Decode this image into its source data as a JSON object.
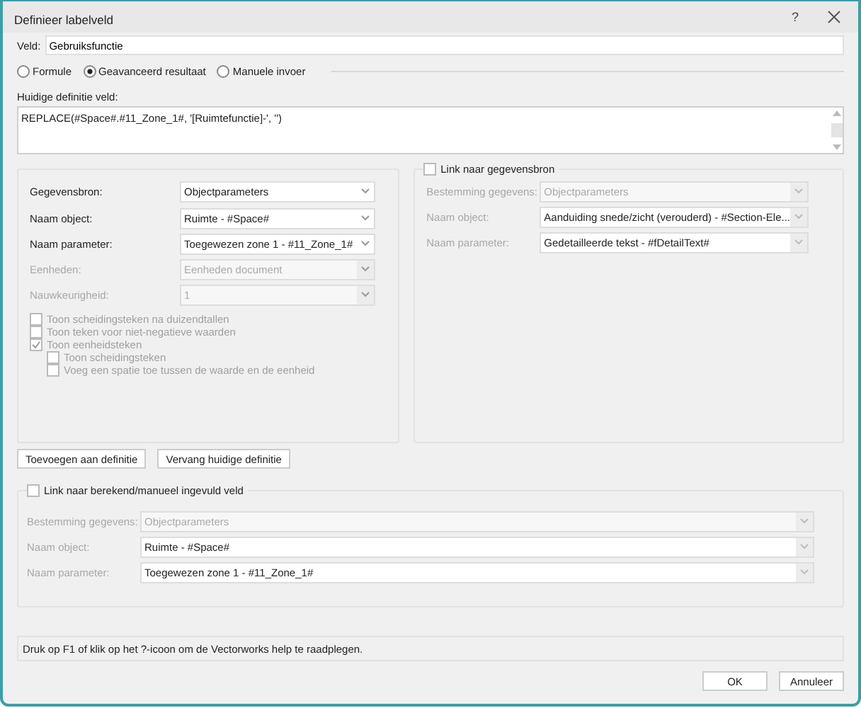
{
  "window": {
    "title": "Definieer labelveld",
    "help": "?"
  },
  "veld": {
    "label": "Veld:",
    "value": "Gebruiksfunctie"
  },
  "mode_options": [
    {
      "label": "Formule",
      "selected": false
    },
    {
      "label": "Geavanceerd resultaat",
      "selected": true
    },
    {
      "label": "Manuele invoer",
      "selected": false
    }
  ],
  "definition": {
    "label": "Huidige definitie veld:",
    "value": "REPLACE(#Space#.#11_Zone_1#, '[Ruimtefunctie]-', '')"
  },
  "source_panel": {
    "rows": [
      {
        "label": "Gegevensbron:",
        "value": "Objectparameters",
        "disabled": false
      },
      {
        "label": "Naam object:",
        "value": "Ruimte - #Space#",
        "disabled": false
      },
      {
        "label": "Naam parameter:",
        "value": "Toegewezen zone 1 - #11_Zone_1#",
        "disabled": false
      },
      {
        "label": "Eenheden:",
        "value": "Eenheden document",
        "disabled": true
      },
      {
        "label": "Nauwkeurigheid:",
        "value": "1",
        "disabled": true
      }
    ],
    "checkboxes": [
      {
        "label": "Toon scheidingsteken na duizendtallen",
        "checked": false,
        "disabled": true
      },
      {
        "label": "Toon teken voor niet-negatieve waarden",
        "checked": false,
        "disabled": true
      },
      {
        "label": "Toon eenheidsteken",
        "checked": true,
        "disabled": true,
        "children": [
          {
            "label": "Toon scheidingsteken",
            "checked": false,
            "disabled": true
          },
          {
            "label": "Voeg een spatie toe tussen de waarde en de eenheid",
            "checked": false,
            "disabled": true
          }
        ]
      }
    ]
  },
  "link_panel": {
    "label": "Link naar gegevensbron",
    "checked": false,
    "rows": [
      {
        "label": "Bestemming gegevens:",
        "value": "Objectparameters",
        "disabled": true
      },
      {
        "label": "Naam object:",
        "value": "Aanduiding snede/zicht (verouderd) - #Section-Ele...",
        "disabled": false
      },
      {
        "label": "Naam parameter:",
        "value": "Gedetailleerde tekst - #fDetailText#",
        "disabled": false
      }
    ]
  },
  "actions": [
    "Toevoegen aan definitie",
    "Vervang huidige definitie"
  ],
  "calc_panel": {
    "label": "Link naar berekend/manueel ingevuld veld",
    "checked": false,
    "rows": [
      {
        "label": "Bestemming gegevens:",
        "value": "Objectparameters",
        "disabled": true
      },
      {
        "label": "Naam object:",
        "value": "Ruimte - #Space#",
        "disabled": false
      },
      {
        "label": "Naam parameter:",
        "value": "Toegewezen zone 1 - #11_Zone_1#",
        "disabled": false
      }
    ]
  },
  "help_text": "Druk op F1 of klik op het ?-icoon om de Vectorworks help te raadplegen.",
  "buttons": [
    "OK",
    "Annuleer"
  ]
}
